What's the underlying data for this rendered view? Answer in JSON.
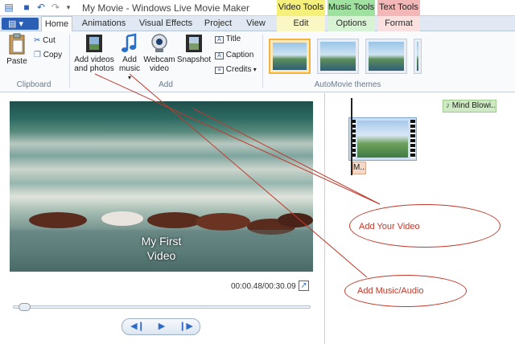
{
  "window": {
    "title": "My Movie - Windows Live Movie Maker"
  },
  "context_tabs": [
    {
      "group": "Video Tools",
      "tab": "Edit",
      "color": "#f5f07a"
    },
    {
      "group": "Music Tools",
      "tab": "Options",
      "color": "#9fe19f"
    },
    {
      "group": "Text Tools",
      "tab": "Format",
      "color": "#f4b7b7"
    }
  ],
  "tabs": [
    "Home",
    "Animations",
    "Visual Effects",
    "Project",
    "View"
  ],
  "ribbon": {
    "clipboard": {
      "paste": "Paste",
      "cut": "Cut",
      "copy": "Copy",
      "label": "Clipboard"
    },
    "add": {
      "add_videos_line1": "Add videos",
      "add_videos_line2": "and photos",
      "add_music_line1": "Add",
      "add_music_line2": "music",
      "webcam_line1": "Webcam",
      "webcam_line2": "video",
      "snapshot": "Snapshot",
      "title": "Title",
      "caption": "Caption",
      "credits": "Credits",
      "label": "Add"
    },
    "automovie": {
      "label": "AutoMovie themes"
    }
  },
  "preview": {
    "overlay_line1": "My First",
    "overlay_line2": "Video",
    "timecode": "00:00.48/00:30.09",
    "progress": 0.016
  },
  "storyboard": {
    "music_label": "Mind Blowi...",
    "caption_label": "M..."
  },
  "annotations": {
    "video": "Add Your Video",
    "music": "Add Music/Audio"
  },
  "colors": {
    "accent": "#2a5fb5",
    "annotation": "#c0392b"
  }
}
